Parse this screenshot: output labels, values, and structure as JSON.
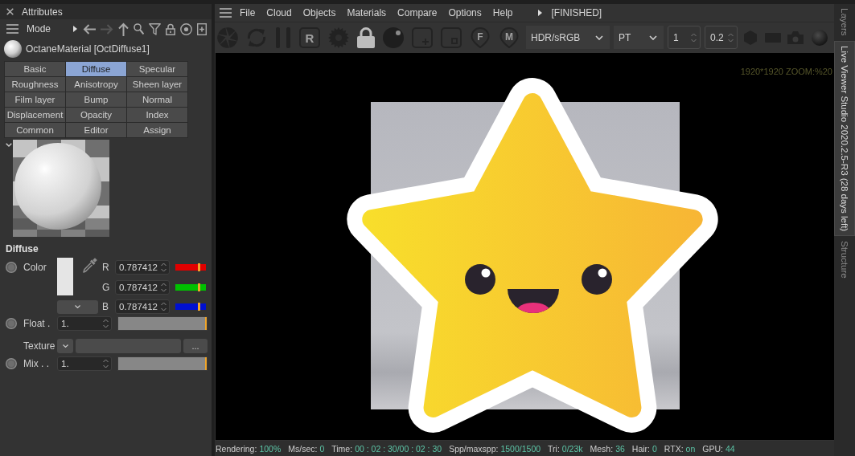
{
  "attributes_panel": {
    "title": "Attributes",
    "mode_menu": "Mode",
    "material_name": "OctaneMaterial [OctDiffuse1]",
    "tabs": [
      {
        "label": "Basic",
        "selected": false
      },
      {
        "label": "Diffuse",
        "selected": true
      },
      {
        "label": "Specular",
        "selected": false
      },
      {
        "label": "Roughness",
        "selected": false
      },
      {
        "label": "Anisotropy",
        "selected": false
      },
      {
        "label": "Sheen layer",
        "selected": false
      },
      {
        "label": "Film layer",
        "selected": false
      },
      {
        "label": "Bump",
        "selected": false
      },
      {
        "label": "Normal",
        "selected": false
      },
      {
        "label": "Displacement",
        "selected": false
      },
      {
        "label": "Opacity",
        "selected": false
      },
      {
        "label": "Index",
        "selected": false
      },
      {
        "label": "Common",
        "selected": false
      },
      {
        "label": "Editor",
        "selected": false
      },
      {
        "label": "Assign",
        "selected": false
      }
    ],
    "section_title": "Diffuse",
    "color": {
      "label": "Color",
      "channels": [
        {
          "name": "R",
          "value": "0.787412",
          "level": 0.787412,
          "color": "#e00000"
        },
        {
          "name": "G",
          "value": "0.787412",
          "level": 0.787412,
          "color": "#00c000"
        },
        {
          "name": "B",
          "value": "0.787412",
          "level": 0.787412,
          "color": "#0010d0"
        }
      ]
    },
    "float": {
      "label": "Float .",
      "value": "1.",
      "level": 1
    },
    "texture": {
      "label": "Texture",
      "browse_button": "..."
    },
    "mix": {
      "label": "Mix . .",
      "value": "1.",
      "level": 1
    }
  },
  "live_viewer": {
    "menu": [
      "File",
      "Cloud",
      "Objects",
      "Materials",
      "Compare",
      "Options",
      "Help"
    ],
    "render_state": "[FINISHED]",
    "toolbar": {
      "letter_buttons": [
        {
          "kind": "box",
          "label": "R"
        },
        {
          "kind": "pin",
          "label": "F"
        },
        {
          "kind": "pin",
          "label": "M"
        }
      ],
      "dropdowns": [
        "HDR/sRGB",
        "PT"
      ],
      "spinners": [
        "1",
        "0.2"
      ]
    },
    "viewport": {
      "overlay_text": "1920*1920 ZOOM:%20"
    },
    "status_bar": [
      {
        "label": "Rendering:",
        "value": "100%"
      },
      {
        "label": "Ms/sec:",
        "value": "0"
      },
      {
        "label": "Time:",
        "value": "00 : 02 : 30/00 : 02 : 30"
      },
      {
        "label": "Spp/maxspp:",
        "value": "1500/1500"
      },
      {
        "label": "Tri:",
        "value": "0/23k"
      },
      {
        "label": "Mesh:",
        "value": "36"
      },
      {
        "label": "Hair:",
        "value": "0"
      },
      {
        "label": "RTX:",
        "value": "on"
      },
      {
        "label": "GPU:",
        "value": "44"
      }
    ]
  },
  "side_tabs": [
    {
      "label": "Layers",
      "selected": false
    },
    {
      "label": "Live Viewer Studio 2020.2.5-R3 (28 days left)",
      "selected": true
    },
    {
      "label": "Structure",
      "selected": false
    }
  ]
}
